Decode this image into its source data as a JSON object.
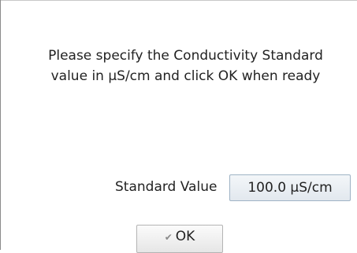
{
  "dialog": {
    "message_line1": "Please specify the Conductivity Standard",
    "message_line2": "value in µS/cm and click OK when ready"
  },
  "standard": {
    "label": "Standard Value",
    "value": "100.0 µS/cm"
  },
  "ok_button": {
    "label": "OK",
    "icon": "check-icon"
  }
}
